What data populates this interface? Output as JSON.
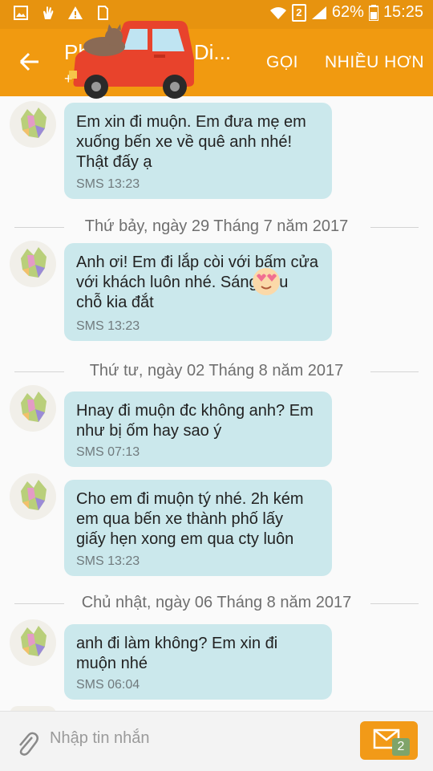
{
  "status_bar": {
    "battery": "62%",
    "time": "15:25",
    "sim": "2"
  },
  "header": {
    "title": "Ph",
    "title_tail": "Di...",
    "subtitle": "+",
    "call": "GỌI",
    "more": "NHIỀU HƠN"
  },
  "messages": [
    {
      "text": "Em xin đi muộn. Em đưa mẹ em\nxuống bến xe về quê anh nhé!\nThật đấy ạ",
      "meta": "SMS 13:23"
    },
    {
      "text": "Anh ơi! Em đi lắp còi với bấm cửa\nvới khách luôn nhé. Sáng     kêu\nchỗ kia đắt",
      "meta": "SMS 13:23"
    },
    {
      "text": "Hnay đi muộn đc không anh? Em\nnhư bị ốm hay sao ý",
      "meta": "SMS 07:13"
    },
    {
      "text": "Cho em đi muộn tý nhé. 2h kém\nem qua bến xe thành phố lấy\ngiấy hẹn xong em qua cty luôn",
      "meta": "SMS 13:23"
    },
    {
      "text": "anh đi làm không? Em xin đi\nmuộn nhé",
      "meta": "SMS 06:04"
    }
  ],
  "dates": [
    "Thứ bảy, ngày 29 Tháng 7 năm 2017",
    "Thứ tư, ngày 02 Tháng 8 năm 2017",
    "Chủ nhật, ngày 06 Tháng 8 năm 2017"
  ],
  "composer": {
    "placeholder": "Nhập tin nhắn",
    "badge": "2"
  },
  "colors": {
    "accent": "#f19a10",
    "bubble": "#cbe8ec"
  },
  "icons": [
    "gallery-icon",
    "gesture-icon",
    "warning-icon",
    "sim-icon",
    "wifi-icon",
    "signal-icon",
    "battery-icon",
    "back-arrow-icon",
    "car-sticker-icon",
    "heart-eyes-emoji-icon",
    "paperclip-icon",
    "send-message-icon"
  ]
}
